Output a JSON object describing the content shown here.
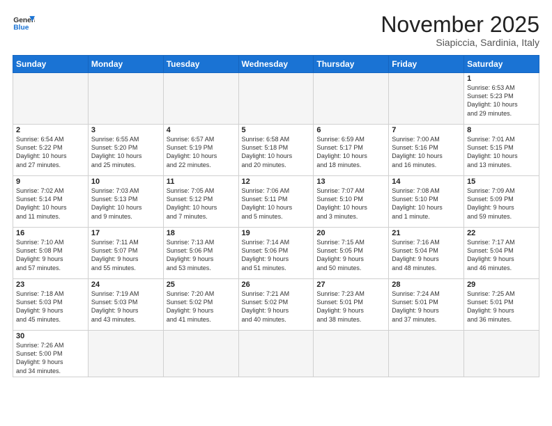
{
  "logo": {
    "line1": "General",
    "line2": "Blue"
  },
  "title": "November 2025",
  "subtitle": "Siapiccia, Sardinia, Italy",
  "weekdays": [
    "Sunday",
    "Monday",
    "Tuesday",
    "Wednesday",
    "Thursday",
    "Friday",
    "Saturday"
  ],
  "weeks": [
    [
      {
        "day": "",
        "info": ""
      },
      {
        "day": "",
        "info": ""
      },
      {
        "day": "",
        "info": ""
      },
      {
        "day": "",
        "info": ""
      },
      {
        "day": "",
        "info": ""
      },
      {
        "day": "",
        "info": ""
      },
      {
        "day": "1",
        "info": "Sunrise: 6:53 AM\nSunset: 5:23 PM\nDaylight: 10 hours\nand 29 minutes."
      }
    ],
    [
      {
        "day": "2",
        "info": "Sunrise: 6:54 AM\nSunset: 5:22 PM\nDaylight: 10 hours\nand 27 minutes."
      },
      {
        "day": "3",
        "info": "Sunrise: 6:55 AM\nSunset: 5:20 PM\nDaylight: 10 hours\nand 25 minutes."
      },
      {
        "day": "4",
        "info": "Sunrise: 6:57 AM\nSunset: 5:19 PM\nDaylight: 10 hours\nand 22 minutes."
      },
      {
        "day": "5",
        "info": "Sunrise: 6:58 AM\nSunset: 5:18 PM\nDaylight: 10 hours\nand 20 minutes."
      },
      {
        "day": "6",
        "info": "Sunrise: 6:59 AM\nSunset: 5:17 PM\nDaylight: 10 hours\nand 18 minutes."
      },
      {
        "day": "7",
        "info": "Sunrise: 7:00 AM\nSunset: 5:16 PM\nDaylight: 10 hours\nand 16 minutes."
      },
      {
        "day": "8",
        "info": "Sunrise: 7:01 AM\nSunset: 5:15 PM\nDaylight: 10 hours\nand 13 minutes."
      }
    ],
    [
      {
        "day": "9",
        "info": "Sunrise: 7:02 AM\nSunset: 5:14 PM\nDaylight: 10 hours\nand 11 minutes."
      },
      {
        "day": "10",
        "info": "Sunrise: 7:03 AM\nSunset: 5:13 PM\nDaylight: 10 hours\nand 9 minutes."
      },
      {
        "day": "11",
        "info": "Sunrise: 7:05 AM\nSunset: 5:12 PM\nDaylight: 10 hours\nand 7 minutes."
      },
      {
        "day": "12",
        "info": "Sunrise: 7:06 AM\nSunset: 5:11 PM\nDaylight: 10 hours\nand 5 minutes."
      },
      {
        "day": "13",
        "info": "Sunrise: 7:07 AM\nSunset: 5:10 PM\nDaylight: 10 hours\nand 3 minutes."
      },
      {
        "day": "14",
        "info": "Sunrise: 7:08 AM\nSunset: 5:10 PM\nDaylight: 10 hours\nand 1 minute."
      },
      {
        "day": "15",
        "info": "Sunrise: 7:09 AM\nSunset: 5:09 PM\nDaylight: 9 hours\nand 59 minutes."
      }
    ],
    [
      {
        "day": "16",
        "info": "Sunrise: 7:10 AM\nSunset: 5:08 PM\nDaylight: 9 hours\nand 57 minutes."
      },
      {
        "day": "17",
        "info": "Sunrise: 7:11 AM\nSunset: 5:07 PM\nDaylight: 9 hours\nand 55 minutes."
      },
      {
        "day": "18",
        "info": "Sunrise: 7:13 AM\nSunset: 5:06 PM\nDaylight: 9 hours\nand 53 minutes."
      },
      {
        "day": "19",
        "info": "Sunrise: 7:14 AM\nSunset: 5:06 PM\nDaylight: 9 hours\nand 51 minutes."
      },
      {
        "day": "20",
        "info": "Sunrise: 7:15 AM\nSunset: 5:05 PM\nDaylight: 9 hours\nand 50 minutes."
      },
      {
        "day": "21",
        "info": "Sunrise: 7:16 AM\nSunset: 5:04 PM\nDaylight: 9 hours\nand 48 minutes."
      },
      {
        "day": "22",
        "info": "Sunrise: 7:17 AM\nSunset: 5:04 PM\nDaylight: 9 hours\nand 46 minutes."
      }
    ],
    [
      {
        "day": "23",
        "info": "Sunrise: 7:18 AM\nSunset: 5:03 PM\nDaylight: 9 hours\nand 45 minutes."
      },
      {
        "day": "24",
        "info": "Sunrise: 7:19 AM\nSunset: 5:03 PM\nDaylight: 9 hours\nand 43 minutes."
      },
      {
        "day": "25",
        "info": "Sunrise: 7:20 AM\nSunset: 5:02 PM\nDaylight: 9 hours\nand 41 minutes."
      },
      {
        "day": "26",
        "info": "Sunrise: 7:21 AM\nSunset: 5:02 PM\nDaylight: 9 hours\nand 40 minutes."
      },
      {
        "day": "27",
        "info": "Sunrise: 7:23 AM\nSunset: 5:01 PM\nDaylight: 9 hours\nand 38 minutes."
      },
      {
        "day": "28",
        "info": "Sunrise: 7:24 AM\nSunset: 5:01 PM\nDaylight: 9 hours\nand 37 minutes."
      },
      {
        "day": "29",
        "info": "Sunrise: 7:25 AM\nSunset: 5:01 PM\nDaylight: 9 hours\nand 36 minutes."
      }
    ],
    [
      {
        "day": "30",
        "info": "Sunrise: 7:26 AM\nSunset: 5:00 PM\nDaylight: 9 hours\nand 34 minutes."
      },
      {
        "day": "",
        "info": ""
      },
      {
        "day": "",
        "info": ""
      },
      {
        "day": "",
        "info": ""
      },
      {
        "day": "",
        "info": ""
      },
      {
        "day": "",
        "info": ""
      },
      {
        "day": "",
        "info": ""
      }
    ]
  ]
}
